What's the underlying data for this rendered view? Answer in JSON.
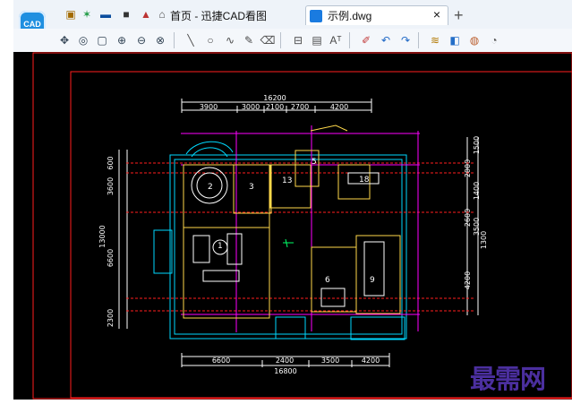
{
  "app": {
    "logo_text": "CAD",
    "home_tab": "首页 - 迅捷CAD看图",
    "file_tab": "示例.dwg",
    "close": "×",
    "new_tab": "+"
  },
  "drawing": {
    "top_total": "16200",
    "top_dims": [
      "3900",
      "3000",
      "2100",
      "2700",
      "4200"
    ],
    "bottom_dims": [
      "6600",
      "2400",
      "3500",
      "4200"
    ],
    "bottom_total": "16800",
    "left_dims": [
      "600",
      "3600",
      "6600",
      "2300"
    ],
    "left_total": "13000",
    "right_dims": [
      "1500",
      "2000",
      "1400",
      "2600",
      "3500",
      "4200"
    ],
    "right_total": "1300",
    "rooms": [
      "2",
      "3",
      "1",
      "13",
      "5",
      "18",
      "6",
      "9"
    ]
  },
  "watermark": "最需网"
}
